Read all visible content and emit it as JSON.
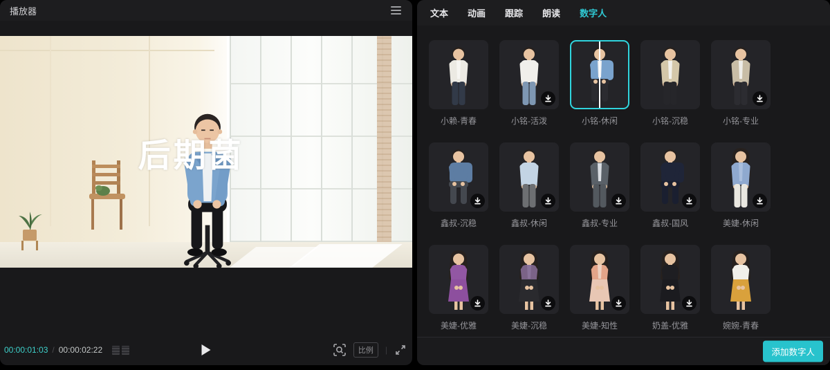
{
  "player": {
    "title": "播放器",
    "overlay_text": "后期菌",
    "timecode_current": "00:00:01:03",
    "timecode_separator": "/",
    "timecode_total": "00:00:02:22",
    "ratio_label": "比例"
  },
  "panel": {
    "tabs": [
      {
        "label": "文本",
        "active": false
      },
      {
        "label": "动画",
        "active": false
      },
      {
        "label": "跟踪",
        "active": false
      },
      {
        "label": "朗读",
        "active": false
      },
      {
        "label": "数字人",
        "active": true
      }
    ],
    "add_button_label": "添加数字人",
    "avatars": [
      {
        "name": "小赖-青春",
        "selected": false,
        "downloadable": false,
        "pose": "stand",
        "hairstyle": "short",
        "outfit": "pants",
        "shirt": "#eceae3",
        "inner": "#f7f6f2",
        "pants": "#323a48"
      },
      {
        "name": "小铭-活泼",
        "selected": false,
        "downloadable": true,
        "pose": "stand",
        "hairstyle": "short",
        "outfit": "pants",
        "shirt": "#f0efeb",
        "inner": "#f0efeb",
        "pants": "#7e97b3"
      },
      {
        "name": "小铭-休闲",
        "selected": true,
        "downloadable": false,
        "pose": "sit",
        "hairstyle": "short",
        "outfit": "pants",
        "shirt": "#7aa3cd",
        "inner": "#eef0f2",
        "pants": "#2b2b30"
      },
      {
        "name": "小铭-沉稳",
        "selected": false,
        "downloadable": false,
        "pose": "stand",
        "hairstyle": "short",
        "outfit": "pants",
        "shirt": "#d4c7a9",
        "inner": "#f2f1ec",
        "pants": "#26262a"
      },
      {
        "name": "小铭-专业",
        "selected": false,
        "downloadable": true,
        "pose": "stand",
        "hairstyle": "short",
        "outfit": "pants",
        "shirt": "#c8bda6",
        "inner": "#efeee9",
        "pants": "#2c2c31"
      },
      {
        "name": "鑫叔-沉稳",
        "selected": false,
        "downloadable": true,
        "pose": "sit",
        "hairstyle": "short",
        "outfit": "pants",
        "shirt": "#5d7da3",
        "inner": "#5d7da3",
        "pants": "#44484f"
      },
      {
        "name": "鑫叔-休闲",
        "selected": false,
        "downloadable": true,
        "pose": "stand",
        "hairstyle": "short",
        "outfit": "pants",
        "shirt": "#c3d4e4",
        "inner": "#c3d4e4",
        "pants": "#6d6f72"
      },
      {
        "name": "鑫叔-专业",
        "selected": false,
        "downloadable": true,
        "pose": "stand",
        "hairstyle": "short",
        "outfit": "pants",
        "shirt": "#5a6168",
        "inner": "#d9dde2",
        "pants": "#53595f"
      },
      {
        "name": "鑫叔-国风",
        "selected": false,
        "downloadable": true,
        "pose": "sit",
        "hairstyle": "short",
        "outfit": "pants",
        "shirt": "#1f2538",
        "inner": "#1f2538",
        "pants": "#1a1f30"
      },
      {
        "name": "美婕-休闲",
        "selected": false,
        "downloadable": true,
        "pose": "stand",
        "hairstyle": "long",
        "outfit": "pants",
        "shirt": "#8fa9cf",
        "inner": "#a9bedd",
        "pants": "#e9e7e0"
      },
      {
        "name": "美婕-优雅",
        "selected": false,
        "downloadable": true,
        "pose": "stand",
        "hairstyle": "long",
        "outfit": "dress",
        "shirt": "#9257a3",
        "inner": "#9257a3",
        "pants": "#8d4f9e"
      },
      {
        "name": "美婕-沉稳",
        "selected": false,
        "downloadable": true,
        "pose": "stand",
        "hairstyle": "long",
        "outfit": "dress",
        "shirt": "#7b6387",
        "inner": "#8a739a",
        "pants": "#2a2a2e"
      },
      {
        "name": "美婕-知性",
        "selected": false,
        "downloadable": true,
        "pose": "stand",
        "hairstyle": "long",
        "outfit": "dress",
        "shirt": "#e3a488",
        "inner": "#ecd0c0",
        "pants": "#e8c7b4"
      },
      {
        "name": "奶盖-优雅",
        "selected": false,
        "downloadable": true,
        "pose": "stand",
        "hairstyle": "long",
        "outfit": "dress",
        "shirt": "#1e1e22",
        "inner": "#1e1e22",
        "pants": "#1b1b1f"
      },
      {
        "name": "婉婉-青春",
        "selected": false,
        "downloadable": false,
        "pose": "stand",
        "hairstyle": "long",
        "outfit": "dress",
        "shirt": "#f1efe9",
        "inner": "#f1efe9",
        "pants": "#d9a13c"
      }
    ]
  },
  "icons": {
    "menu": "hamburger-icon",
    "frames": "frame-list-icon",
    "play": "play-icon",
    "preview_quality": "focus-magnifier-icon",
    "fullscreen": "expand-icon",
    "download": "download-icon"
  },
  "theme": {
    "accent": "#2fc9d4",
    "timecode": "#3ed0ca",
    "selected_border": "#30d5de",
    "button_bg": "#28c3cd",
    "panel_bg": "#19191b"
  }
}
